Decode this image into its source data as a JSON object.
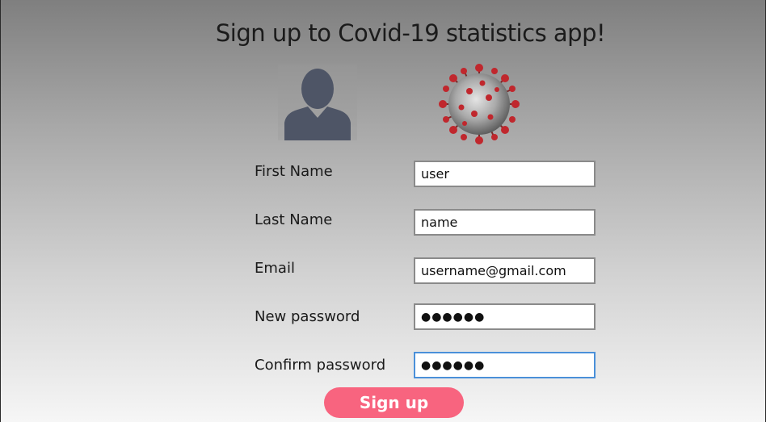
{
  "page": {
    "title": "Sign up to Covid-19 statistics app!"
  },
  "images": {
    "user_icon": "user-avatar-icon",
    "virus_icon": "coronavirus-icon"
  },
  "form": {
    "first_name": {
      "label": "First Name",
      "value": "user"
    },
    "last_name": {
      "label": "Last Name",
      "value": "name"
    },
    "email": {
      "label": "Email",
      "value": "username@gmail.com"
    },
    "new_password": {
      "label": "New password",
      "value": "●●●●●●"
    },
    "confirm_password": {
      "label": "Confirm password",
      "value": "●●●●●●"
    }
  },
  "submit": {
    "label": "Sign up"
  },
  "colors": {
    "accent": "#f8647f",
    "focus_border": "#4a90d9",
    "avatar": "#4e5566"
  }
}
